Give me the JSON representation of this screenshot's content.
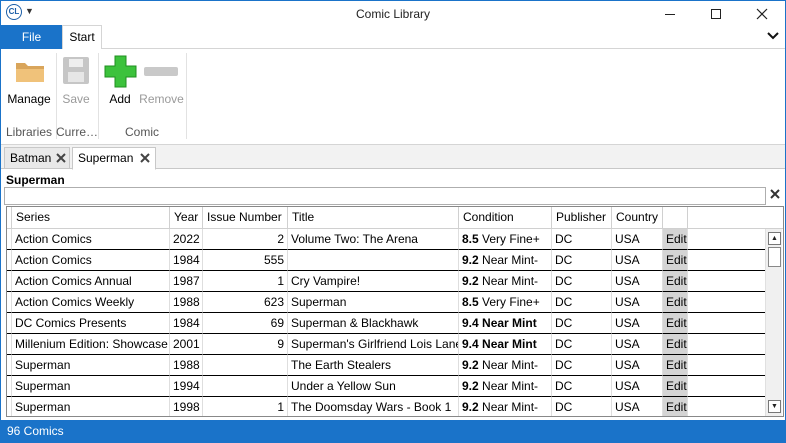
{
  "window": {
    "title": "Comic Library",
    "app_icon_text": "CL",
    "accent_color": "#1a73c9"
  },
  "ribbon": {
    "tabs": {
      "file": "File",
      "start": "Start"
    },
    "buttons": {
      "manage": "Manage",
      "save": "Save",
      "add": "Add",
      "remove": "Remove"
    },
    "groups": {
      "libraries": "Libraries",
      "current": "Curre…",
      "comic": "Comic"
    }
  },
  "document_tabs": [
    {
      "label": "Batman",
      "active": false
    },
    {
      "label": "Superman",
      "active": true
    }
  ],
  "section_title": "Superman",
  "filter": {
    "value": ""
  },
  "grid": {
    "columns": [
      "Series",
      "Year",
      "Issue Number",
      "Title",
      "Condition",
      "Publisher",
      "Country"
    ],
    "rows": [
      {
        "series": "Action Comics",
        "year": "2022",
        "issue": "2",
        "title": "Volume Two: The Arena",
        "grade": "8.5",
        "condition": "Very Fine+",
        "cond_bold": false,
        "publisher": "DC",
        "country": "USA",
        "edit": "Edit"
      },
      {
        "series": "Action Comics",
        "year": "1984",
        "issue": "555",
        "title": "",
        "grade": "9.2",
        "condition": "Near Mint-",
        "cond_bold": false,
        "publisher": "DC",
        "country": "USA",
        "edit": "Edit"
      },
      {
        "series": "Action Comics Annual",
        "year": "1987",
        "issue": "1",
        "title": "Cry Vampire!",
        "grade": "9.2",
        "condition": "Near Mint-",
        "cond_bold": false,
        "publisher": "DC",
        "country": "USA",
        "edit": "Edit"
      },
      {
        "series": "Action Comics Weekly",
        "year": "1988",
        "issue": "623",
        "title": "Superman",
        "grade": "8.5",
        "condition": "Very Fine+",
        "cond_bold": false,
        "publisher": "DC",
        "country": "USA",
        "edit": "Edit"
      },
      {
        "series": "DC Comics Presents",
        "year": "1984",
        "issue": "69",
        "title": "Superman & Blackhawk",
        "grade": "9.4",
        "condition": "Near Mint",
        "cond_bold": true,
        "publisher": "DC",
        "country": "USA",
        "edit": "Edit"
      },
      {
        "series": "Millenium Edition: Showcase",
        "year": "2001",
        "issue": "9",
        "title": "Superman's Girlfriend Lois Lane",
        "grade": "9.4",
        "condition": "Near Mint",
        "cond_bold": true,
        "publisher": "DC",
        "country": "USA",
        "edit": "Edit"
      },
      {
        "series": "Superman",
        "year": "1988",
        "issue": "",
        "title": "The Earth Stealers",
        "grade": "9.2",
        "condition": "Near Mint-",
        "cond_bold": false,
        "publisher": "DC",
        "country": "USA",
        "edit": "Edit"
      },
      {
        "series": "Superman",
        "year": "1994",
        "issue": "",
        "title": "Under a Yellow Sun",
        "grade": "9.2",
        "condition": "Near Mint-",
        "cond_bold": false,
        "publisher": "DC",
        "country": "USA",
        "edit": "Edit"
      },
      {
        "series": "Superman",
        "year": "1998",
        "issue": "1",
        "title": "The Doomsday Wars - Book 1",
        "grade": "9.2",
        "condition": "Near Mint-",
        "cond_bold": false,
        "publisher": "DC",
        "country": "USA",
        "edit": "Edit"
      }
    ]
  },
  "status": {
    "count_text": "96 Comics"
  }
}
